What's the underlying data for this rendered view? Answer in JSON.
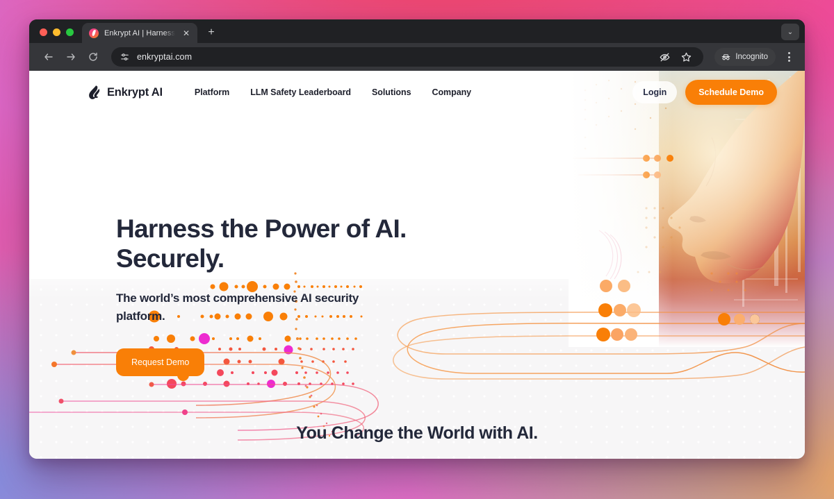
{
  "browser": {
    "tab": {
      "title": "Enkrypt AI | Harness the Powe",
      "close_label": "✕",
      "favicon_name": "enkrypt-favicon"
    },
    "new_tab_label": "+",
    "tabstrip_chevron": "⌄",
    "toolbar": {
      "back_label": "back",
      "forward_label": "forward",
      "reload_label": "reload",
      "url": "enkryptai.com",
      "site_settings_icon": "tune-icon",
      "blocked_icon": "eye-slash-icon",
      "bookmark_icon": "star-icon",
      "incognito_label": "Incognito",
      "menu_icon": "kebab-menu-icon"
    }
  },
  "site": {
    "brand": "Enkrypt AI",
    "nav_links": [
      {
        "label": "Platform"
      },
      {
        "label": "LLM Safety Leaderboard"
      },
      {
        "label": "Solutions"
      },
      {
        "label": "Company"
      }
    ],
    "login_label": "Login",
    "demo_label": "Schedule Demo",
    "hero": {
      "heading_line1": "Harness the Power of AI.",
      "heading_line2": "Securely.",
      "subheading": "The world’s most comprehensive AI security platform.",
      "cta_label": "Request Demo"
    },
    "bottom_headline": "You Change the World with AI."
  },
  "colors": {
    "accent_orange": "#f97f07",
    "heading_navy": "#23283a",
    "magenta_dot": "#ed2bd0",
    "pink_dot": "#f44f63",
    "browser_chrome": "#35363a",
    "tabstrip": "#202124"
  }
}
